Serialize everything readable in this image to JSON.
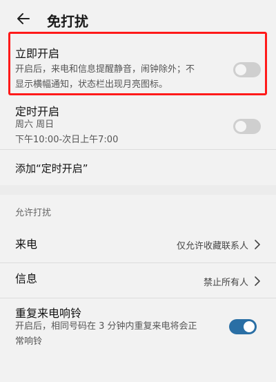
{
  "header": {
    "title": "免打扰",
    "back_icon": "back-arrow-icon"
  },
  "immediate": {
    "title": "立即开启",
    "desc_line1": "开启后，来电和信息提醒静音，闹钟除外；不",
    "desc_line2": "显示横幅通知，状态栏出现月亮图标。",
    "enabled": false
  },
  "scheduled": {
    "title": "定时开启",
    "days": "周六 周日",
    "time": "下午10:00-次日上午7:00",
    "enabled": false
  },
  "add_schedule": {
    "label": "添加“定时开启”"
  },
  "allow_section": {
    "label": "允许打扰",
    "calls": {
      "title": "来电",
      "value": "仅允许收藏联系人"
    },
    "messages": {
      "title": "信息",
      "value": "禁止所有人"
    }
  },
  "repeat_calls": {
    "title": "重复来电响铃",
    "desc_line1": "开启后，相同号码在 3 分钟内重复来电将会正",
    "desc_line2": "常响铃",
    "enabled": true
  },
  "colors": {
    "highlight": "#ff1a1a",
    "toggle_on": "#2a6fa5",
    "toggle_off": "#cfcfcf"
  }
}
